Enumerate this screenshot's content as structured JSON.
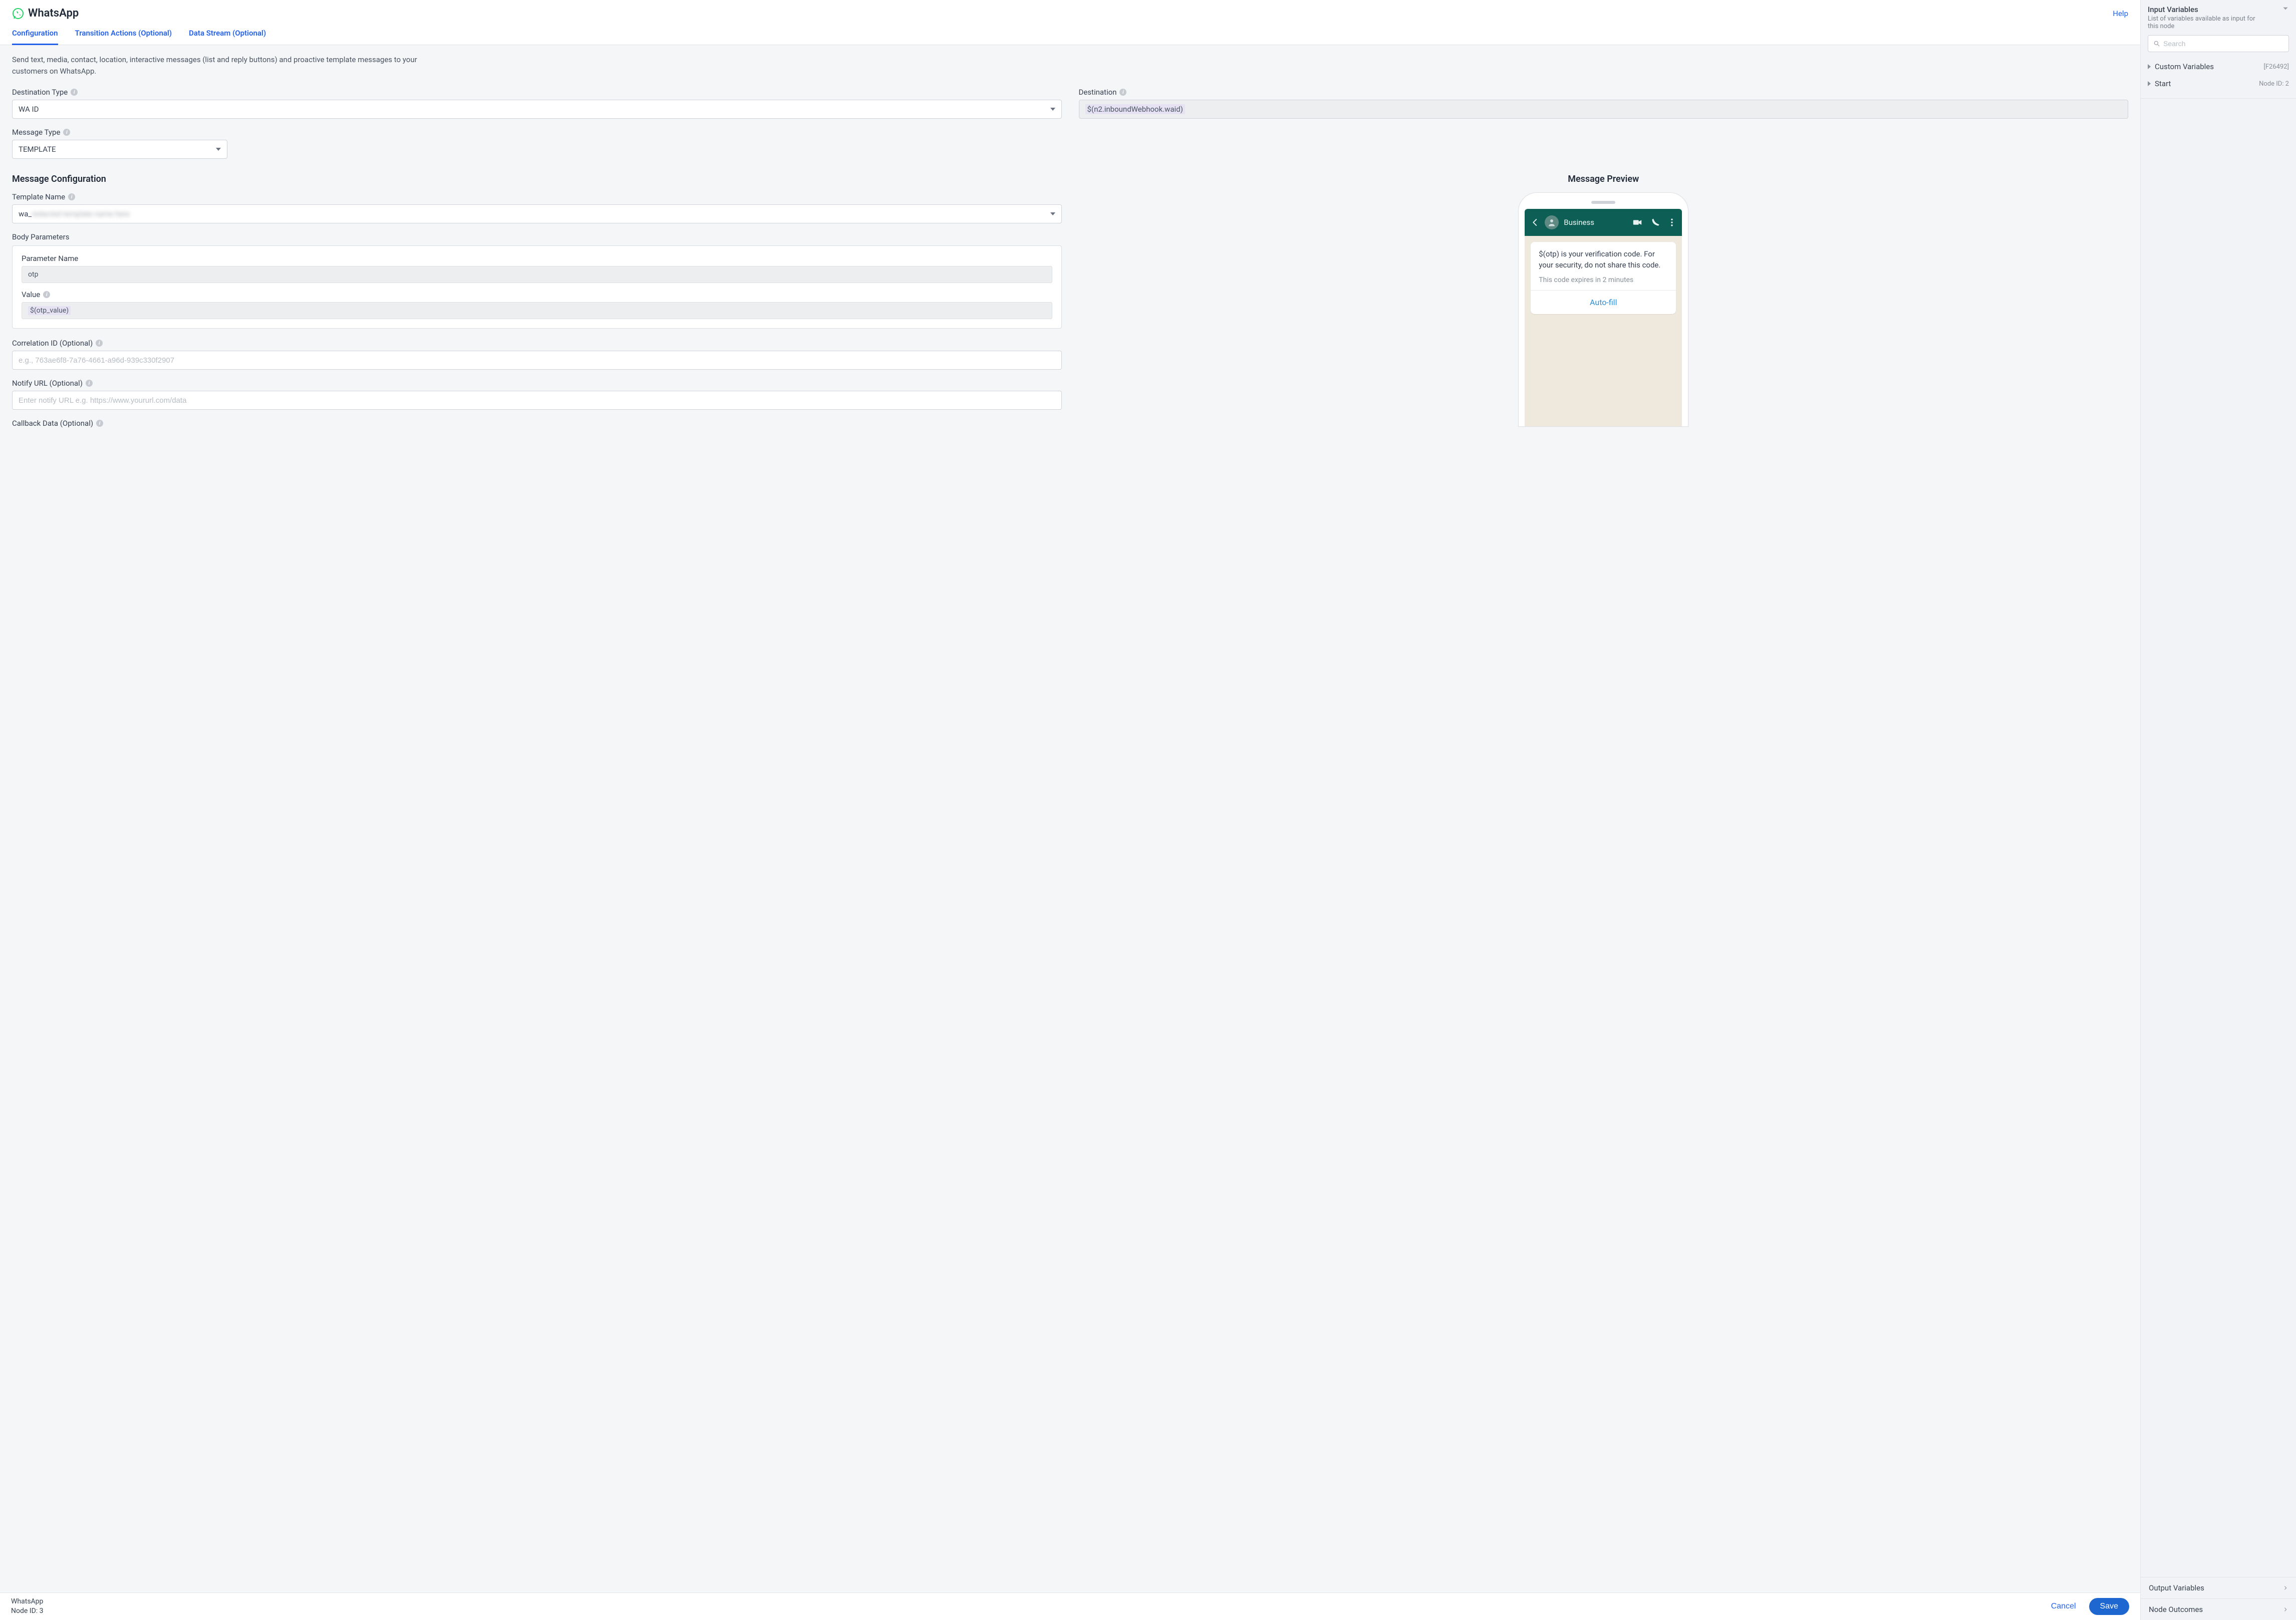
{
  "header": {
    "title": "WhatsApp",
    "help": "Help"
  },
  "tabs": {
    "configuration": "Configuration",
    "transition": "Transition Actions (Optional)",
    "datastream": "Data Stream (Optional)"
  },
  "intro": "Send text, media, contact, location, interactive messages (list and reply buttons) and proactive template messages to your customers on WhatsApp.",
  "form": {
    "destination_type": {
      "label": "Destination Type",
      "value": "WA ID"
    },
    "destination": {
      "label": "Destination",
      "value": "$(n2.inboundWebhook.waid)"
    },
    "message_type": {
      "label": "Message Type",
      "value": "TEMPLATE"
    },
    "message_config_header": "Message Configuration",
    "template_name": {
      "label": "Template Name",
      "value": "wa_████████████████████████"
    },
    "body_params_header": "Body Parameters",
    "body_param": {
      "name_label": "Parameter Name",
      "name_value": "otp",
      "value_label": "Value",
      "value_value": "$(otp_value)"
    },
    "correlation": {
      "label": "Correlation ID (Optional)",
      "placeholder": "e.g., 763ae6f8-7a76-4661-a96d-939c330f2907"
    },
    "notify": {
      "label": "Notify URL (Optional)",
      "placeholder": "Enter notify URL e.g. https://www.yoururl.com/data"
    },
    "callback": {
      "label": "Callback Data (Optional)"
    }
  },
  "preview": {
    "header": "Message Preview",
    "business": "Business",
    "body": "$(otp) is your verification code. For your security, do not share this code.",
    "hint": "This code expires in 2 minutes",
    "action": "Auto-fill"
  },
  "footer": {
    "name": "WhatsApp",
    "node_id": "Node ID: 3",
    "cancel": "Cancel",
    "save": "Save"
  },
  "right": {
    "input_vars": {
      "title": "Input Variables",
      "subtitle": "List of variables available as input for this node",
      "search_placeholder": "Search",
      "items": [
        {
          "label": "Custom Variables",
          "tag": "[F26492]"
        },
        {
          "label": "Start",
          "tag": "Node ID: 2"
        }
      ]
    },
    "output_vars": "Output Variables",
    "node_outcomes": "Node Outcomes"
  }
}
